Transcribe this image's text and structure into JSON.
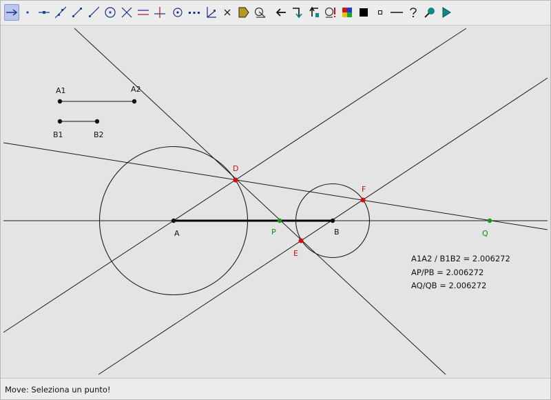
{
  "status": {
    "message": "Move: Seleziona un punto!"
  },
  "labels": {
    "A1": "A1",
    "A2": "A2",
    "B1": "B1",
    "B2": "B2",
    "A": "A",
    "B": "B",
    "P": "P",
    "Q": "Q",
    "D": "D",
    "E": "E",
    "F": "F"
  },
  "readouts": {
    "ratio_segments": "A1A2 / B1B2 = 2.006272",
    "ratio_p": "AP/PB = 2.006272",
    "ratio_q": "AQ/QB = 2.006272"
  },
  "colors": {
    "black_point": "#111111",
    "red_point": "#cc1111",
    "green_point": "#119911",
    "red_label": "#bb1111",
    "green_label": "#118811"
  },
  "toolbar": {
    "tools": [
      "move-arrow-icon",
      "point-icon",
      "point-on-line-icon",
      "line-icon",
      "segment-icon",
      "ray-icon",
      "circle-icon",
      "intersection-icon",
      "parallel-icon",
      "perpendicular-icon",
      "midpoint-icon",
      "midpoint-dots-icon",
      "angle-icon",
      "delete-icon",
      "fill-polygon-icon",
      "measure-icon",
      "undo-arrow-icon",
      "redo-arrow-icon",
      "rotate-icon",
      "locus-icon",
      "color-palette-icon",
      "black-square-icon",
      "small-square-icon",
      "dash-line-icon",
      "help-icon",
      "zoom-icon",
      "play-icon"
    ]
  }
}
